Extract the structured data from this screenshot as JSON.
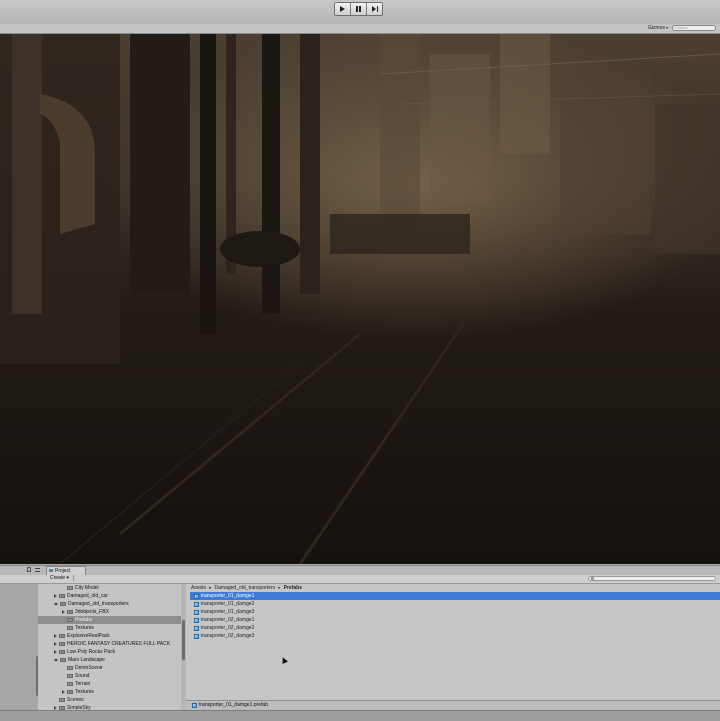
{
  "toolbar": {
    "play_label": "",
    "pause_label": "",
    "step_label": ""
  },
  "game_header": {
    "gizmos_label": "Gizmos",
    "search_placeholder": "Search"
  },
  "project_panel": {
    "tab_label": "Project",
    "create_label": "Create",
    "tree": [
      {
        "label": "City Model",
        "depth": 2,
        "arrow": "none"
      },
      {
        "label": "Damaged_old_car",
        "depth": 1,
        "arrow": "right"
      },
      {
        "label": "Damaged_old_transporters",
        "depth": 1,
        "arrow": "down"
      },
      {
        "label": "3dobjects_FBX",
        "depth": 2,
        "arrow": "right"
      },
      {
        "label": "Prefabs",
        "depth": 2,
        "arrow": "none",
        "selected": true
      },
      {
        "label": "Textures",
        "depth": 2,
        "arrow": "none"
      },
      {
        "label": "ExplosiveRealPack",
        "depth": 1,
        "arrow": "right"
      },
      {
        "label": "HEROIC FANTASY CREATURES FULL PACK",
        "depth": 1,
        "arrow": "right"
      },
      {
        "label": "Low Poly Rocks Pack",
        "depth": 1,
        "arrow": "right"
      },
      {
        "label": "Mars Landscape",
        "depth": 1,
        "arrow": "down"
      },
      {
        "label": "DemoScene",
        "depth": 2,
        "arrow": "none"
      },
      {
        "label": "Sound",
        "depth": 2,
        "arrow": "none"
      },
      {
        "label": "Terrain",
        "depth": 2,
        "arrow": "none"
      },
      {
        "label": "Textures",
        "depth": 2,
        "arrow": "right"
      },
      {
        "label": "Scenes",
        "depth": 1,
        "arrow": "none"
      },
      {
        "label": "SimpleSky",
        "depth": 1,
        "arrow": "right"
      }
    ],
    "breadcrumb": [
      "Assets",
      "Damaged_old_transporters",
      "Prefabs"
    ],
    "assets": [
      {
        "label": "transporter_01_damge1",
        "selected": true
      },
      {
        "label": "transporter_01_damge2"
      },
      {
        "label": "transporter_01_damge3"
      },
      {
        "label": "transporter_02_damge1"
      },
      {
        "label": "transporter_02_damge2"
      },
      {
        "label": "transporter_02_damge3"
      }
    ],
    "status_path": "transporter_01_damge1.prefab"
  },
  "colors": {
    "selection_blue": "#3d7bd8",
    "panel_gray": "#c6c6c6"
  },
  "icons": [
    "play-icon",
    "pause-icon",
    "step-icon",
    "lock-icon",
    "menu-icon",
    "folder-icon",
    "prefab-icon",
    "search-icon"
  ]
}
